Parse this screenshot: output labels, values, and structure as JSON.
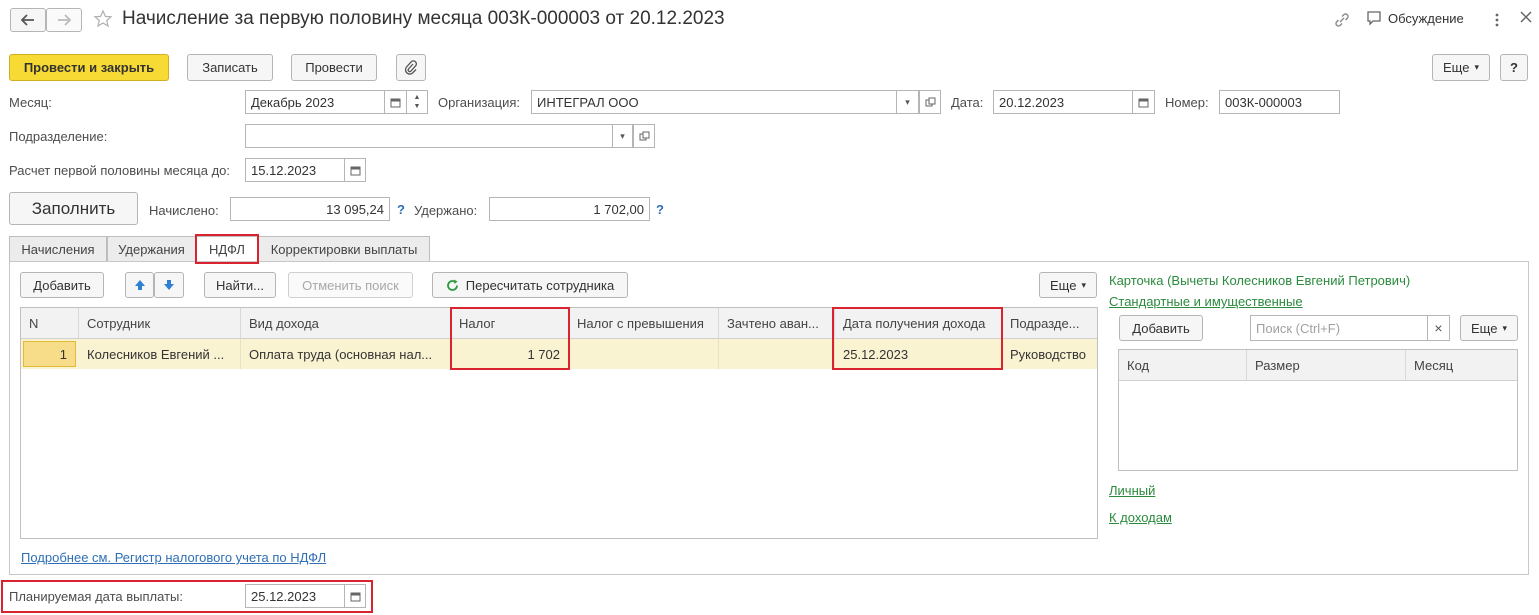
{
  "window": {
    "title": "Начисление за первую половину месяца 003К-000003 от 20.12.2023",
    "discussion_label": "Обсуждение"
  },
  "toolbar": {
    "post_close": "Провести и закрыть",
    "write": "Записать",
    "post": "Провести",
    "more": "Еще",
    "help": "?"
  },
  "form": {
    "month_label": "Месяц:",
    "month_value": "Декабрь 2023",
    "org_label": "Организация:",
    "org_value": "ИНТЕГРАЛ ООО",
    "date_label": "Дата:",
    "date_value": "20.12.2023",
    "number_label": "Номер:",
    "number_value": "003К-000003",
    "division_label": "Подразделение:",
    "division_value": "",
    "calc_label": "Расчет первой половины месяца до:",
    "calc_value": "15.12.2023",
    "fill_button": "Заполнить",
    "accrued_label": "Начислено:",
    "accrued_value": "13 095,24",
    "withheld_label": "Удержано:",
    "withheld_value": "1 702,00",
    "q": "?"
  },
  "tabs": [
    "Начисления",
    "Удержания",
    "НДФЛ",
    "Корректировки выплаты"
  ],
  "ndfl": {
    "add": "Добавить",
    "find": "Найти...",
    "cancel_search": "Отменить поиск",
    "recalc": "Пересчитать сотрудника",
    "more": "Еще",
    "columns": [
      "N",
      "Сотрудник",
      "Вид дохода",
      "Налог",
      "Налог с превышения",
      "Зачтено аван...",
      "Дата получения дохода",
      "Подразде..."
    ],
    "row": [
      "1",
      "Колесников Евгений ...",
      "Оплата труда (основная нал...",
      "1 702",
      "",
      "",
      "25.12.2023",
      "Руководство"
    ],
    "register_link": "Подробнее см. Регистр налогового учета по НДФЛ"
  },
  "card": {
    "title": "Карточка (Вычеты Колесников Евгений Петрович)",
    "standard_link": "Стандартные и имущественные",
    "add": "Добавить",
    "search_placeholder": "Поиск (Ctrl+F)",
    "clear": "×",
    "more": "Еще",
    "columns": [
      "Код",
      "Размер",
      "Месяц"
    ],
    "personal_link": "Личный",
    "income_link": "К доходам"
  },
  "footer": {
    "planned_label": "Планируемая дата выплаты:",
    "planned_value": "25.12.2023"
  }
}
